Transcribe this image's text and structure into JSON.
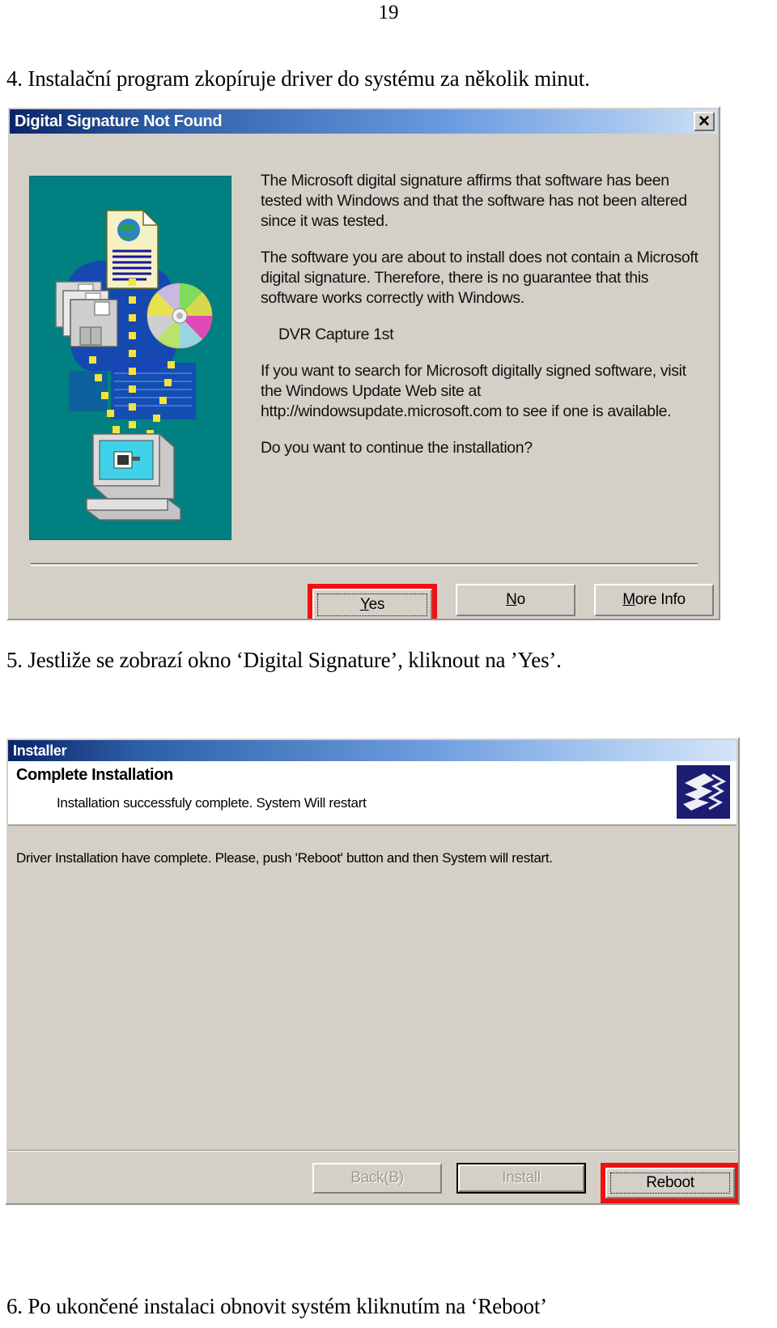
{
  "document": {
    "page_number": "19",
    "step4": "4. Instalační program zkopíruje driver do systému za několik minut.",
    "step5": "5. Jestliže se zobrazí okno ‘Digital Signature’, kliknout na ’Yes’.",
    "step6": "6. Po ukončené instalaci obnovit systém kliknutím na ‘Reboot’"
  },
  "dialog_signature": {
    "title": "Digital Signature Not Found",
    "close_label": "✕",
    "paragraph1": "The Microsoft digital signature affirms that software has been tested with Windows and that the software has not been altered since it was tested.",
    "paragraph2": "The software you are about to install does not contain a Microsoft digital signature. Therefore,  there is no guarantee that this software works correctly with Windows.",
    "driver_name": "DVR Capture 1st",
    "paragraph3": "If you want to search for Microsoft digitally signed software, visit the Windows Update Web site at http://windowsupdate.microsoft.com to see if one is available.",
    "question": "Do you want to continue the installation?",
    "buttons": [
      {
        "label": "Yes",
        "accel": "Y",
        "focused": true,
        "highlighted": true,
        "disabled": false
      },
      {
        "label": "No",
        "accel": "N",
        "focused": false,
        "highlighted": false,
        "disabled": false
      },
      {
        "label": "More Info",
        "accel": "M",
        "focused": false,
        "highlighted": false,
        "disabled": false
      }
    ],
    "illustration": {
      "name": "driver-install-illustration",
      "background_color": "#008080",
      "elements": [
        "document-with-globe-icon",
        "floppy-disks-icon",
        "compact-disc-icon",
        "desktop-computer-icon",
        "yellow-data-dots"
      ]
    }
  },
  "dialog_installer": {
    "title": "Installer",
    "heading": "Complete Installation",
    "subheading": "Installation successfuly complete. System Will restart",
    "message": "Driver Installation have complete. Please, push 'Reboot' button and then System will restart.",
    "icon_name": "installer-hand-logo",
    "icon_color": "#1c1c72",
    "buttons": [
      {
        "label": "Back(B)",
        "accel": "B",
        "disabled": true,
        "default": false,
        "highlighted": false
      },
      {
        "label": "Install",
        "accel": "",
        "disabled": true,
        "default": true,
        "highlighted": false
      },
      {
        "label": "Reboot",
        "accel": "",
        "disabled": false,
        "default": false,
        "highlighted": true
      }
    ]
  },
  "colors": {
    "dialog_face": "#d4d0c8",
    "titlebar_start": "#0a246a",
    "titlebar_end": "#cfe0f5",
    "highlight_red": "#ee1111",
    "illustration_teal": "#008080"
  }
}
